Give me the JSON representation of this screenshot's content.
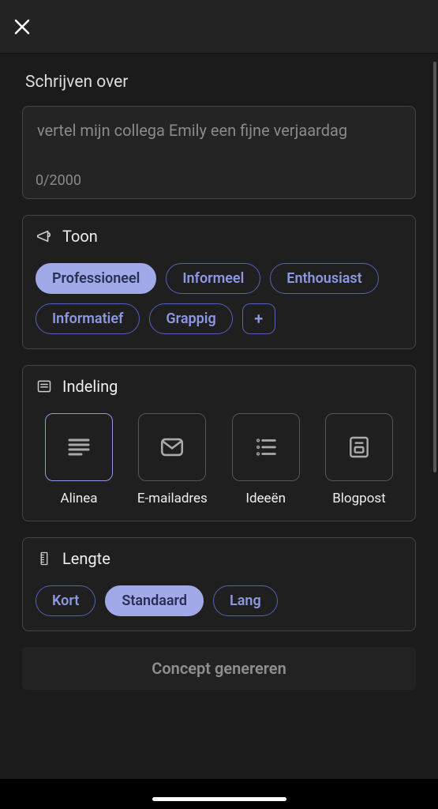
{
  "header": {
    "close_aria": "Sluiten"
  },
  "prompt": {
    "title": "Schrijven over",
    "placeholder": "vertel mijn collega Emily een fijne verjaardag",
    "value": "",
    "counter": "0/2000"
  },
  "tone": {
    "label": "Toon",
    "options": [
      {
        "label": "Professioneel",
        "selected": true
      },
      {
        "label": "Informeel",
        "selected": false
      },
      {
        "label": "Enthousiast",
        "selected": false
      },
      {
        "label": "Informatief",
        "selected": false
      },
      {
        "label": "Grappig",
        "selected": false
      }
    ],
    "add_label": "+"
  },
  "format": {
    "label": "Indeling",
    "options": [
      {
        "label": "Alinea",
        "icon": "paragraph",
        "selected": true
      },
      {
        "label": "E-mailadres",
        "icon": "mail",
        "selected": false
      },
      {
        "label": "Ideeën",
        "icon": "list",
        "selected": false
      },
      {
        "label": "Blogpost",
        "icon": "blog",
        "selected": false
      }
    ]
  },
  "length": {
    "label": "Lengte",
    "options": [
      {
        "label": "Kort",
        "selected": false
      },
      {
        "label": "Standaard",
        "selected": true
      },
      {
        "label": "Lang",
        "selected": false
      }
    ]
  },
  "generate_label": "Concept genereren"
}
